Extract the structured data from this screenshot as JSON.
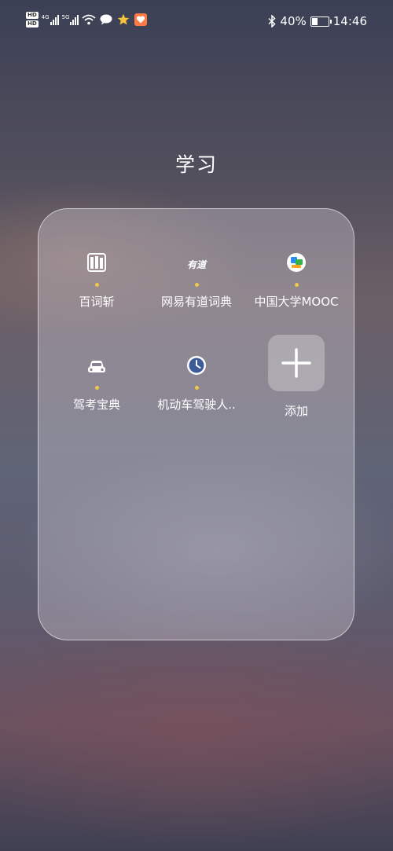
{
  "status_bar": {
    "sim1": "HD",
    "sim2": "HD",
    "net1": "4G",
    "net2": "5G",
    "battery_percent": "40%",
    "battery_level": 0.4,
    "time": "14:46"
  },
  "folder": {
    "title": "学习",
    "apps": [
      {
        "label": "百词斩",
        "icon": "baicizhan-icon"
      },
      {
        "label": "网易有道词典",
        "icon": "youdao-icon",
        "icon_text": "有道"
      },
      {
        "label": "中国大学MOOC",
        "icon": "mooc-icon"
      },
      {
        "label": "驾考宝典",
        "icon": "car-icon"
      },
      {
        "label": "机动车驾驶人..",
        "icon": "clock-icon"
      }
    ],
    "add_label": "添加"
  }
}
